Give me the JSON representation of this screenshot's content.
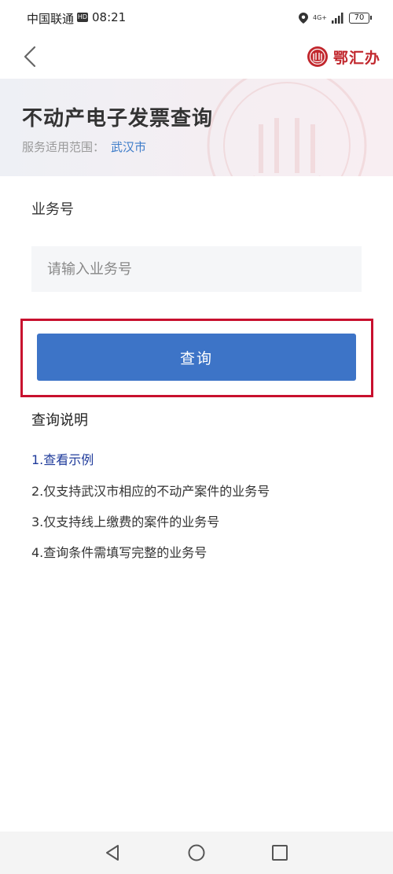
{
  "status_bar": {
    "carrier": "中国联通",
    "hd": "HD",
    "time": "08:21",
    "network": "4G+",
    "battery": "70"
  },
  "nav": {
    "brand": "鄂汇办"
  },
  "hero": {
    "title": "不动产电子发票查询",
    "scope_label": "服务适用范围：",
    "scope_city": "武汉市"
  },
  "form": {
    "field_label": "业务号",
    "placeholder": "请输入业务号",
    "value": "",
    "submit_label": "查询"
  },
  "notes": {
    "title": "查询说明",
    "items": [
      "1.查看示例",
      "2.仅支持武汉市相应的不动产案件的业务号",
      "3.仅支持线上缴费的案件的业务号",
      "4.查询条件需填写完整的业务号"
    ]
  },
  "colors": {
    "accent": "#3d74c7",
    "brand": "#c1272d",
    "highlight": "#c8102e",
    "link": "#1f3b9b"
  }
}
